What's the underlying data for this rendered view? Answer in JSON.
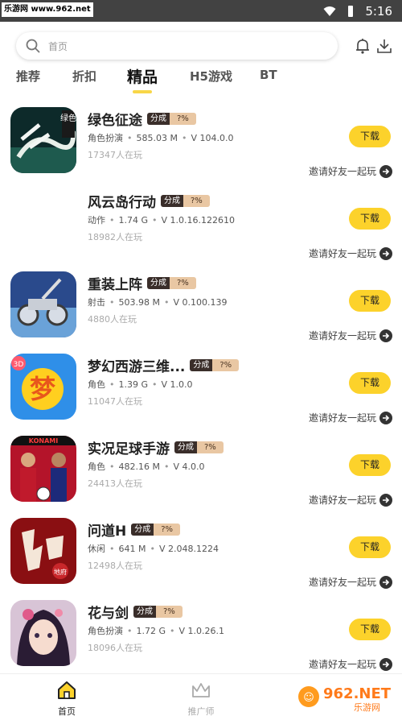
{
  "statusbar": {
    "watermark": "乐游网 www.962.net",
    "time": "5:16"
  },
  "search": {
    "placeholder": "首页"
  },
  "tabs": [
    {
      "label": "推荐",
      "active": false
    },
    {
      "label": "折扣",
      "active": false
    },
    {
      "label": "精品",
      "active": true
    },
    {
      "label": "H5游戏",
      "active": false
    },
    {
      "label": "BT",
      "active": false
    }
  ],
  "accent_color": "#fcd22b",
  "common": {
    "tag_a": "分成",
    "tag_b": "?%",
    "download_label": "下载",
    "invite_label": "邀请好友一起玩"
  },
  "games": [
    {
      "title": "绿色征途",
      "category": "角色扮演",
      "size": "585.03 M",
      "version": "V 104.0.0",
      "players": "17347人在玩",
      "icon_text": "绿色"
    },
    {
      "title": "风云岛行动",
      "category": "动作",
      "size": "1.74 G",
      "version": "V 1.0.16.122610",
      "players": "18982人在玩",
      "icon_text": ""
    },
    {
      "title": "重装上阵",
      "category": "射击",
      "size": "503.98 M",
      "version": "V 0.100.139",
      "players": "4880人在玩",
      "icon_text": ""
    },
    {
      "title": "梦幻西游三维...",
      "category": "角色",
      "size": "1.39 G",
      "version": "V 1.0.0",
      "players": "11047人在玩",
      "icon_text": "3D"
    },
    {
      "title": "实况足球手游",
      "category": "角色",
      "size": "482.16 M",
      "version": "V 4.0.0",
      "players": "24413人在玩",
      "icon_text": "KONAMI"
    },
    {
      "title": "问道H",
      "category": "休闲",
      "size": "641 M",
      "version": "V 2.048.1224",
      "players": "12498人在玩",
      "icon_text": "地府"
    },
    {
      "title": "花与剑",
      "category": "角色扮演",
      "size": "1.72 G",
      "version": "V 1.0.26.1",
      "players": "18096人在玩",
      "icon_text": ""
    }
  ],
  "bottom_nav": [
    {
      "label": "首页",
      "active": true
    },
    {
      "label": "推广师",
      "active": false
    }
  ],
  "watermark_br": {
    "line1": "962.NET",
    "line2": "乐游网"
  }
}
